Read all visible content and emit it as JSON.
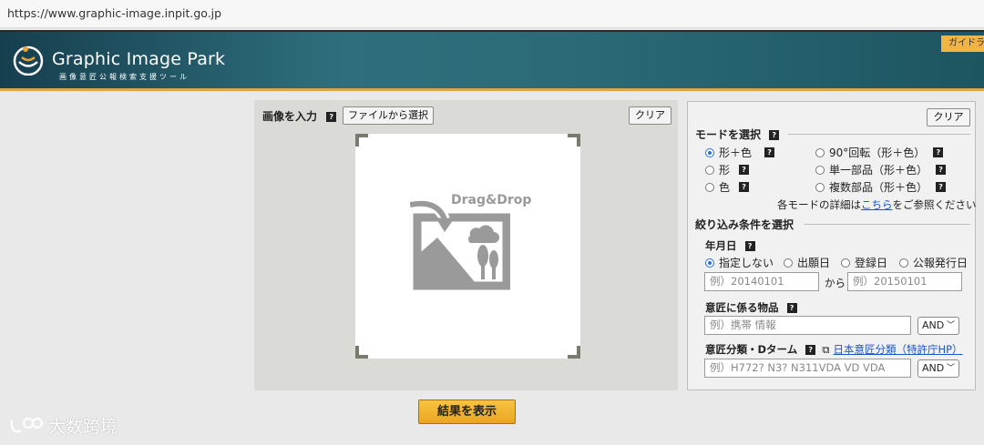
{
  "browser": {
    "url": "https://www.graphic-image.inpit.go.jp"
  },
  "header": {
    "title": "Graphic Image Park",
    "subtitle": "画像意匠公報検索支援ツール",
    "guide_tab": "ガイドラ",
    "colors": {
      "band": "#2b6976",
      "accent": "#e3a53b"
    }
  },
  "input_panel": {
    "title": "画像を入力",
    "file_button": "ファイルから選択",
    "clear_button": "クリア",
    "drop_text": "Drag&Drop"
  },
  "mode_panel": {
    "clear_button": "クリア",
    "title": "モードを選択",
    "modes": [
      {
        "label": "形＋色",
        "selected": true
      },
      {
        "label": "90°回転（形＋色）",
        "selected": false
      },
      {
        "label": "形",
        "selected": false
      },
      {
        "label": "単一部品（形＋色）",
        "selected": false
      },
      {
        "label": "色",
        "selected": false
      },
      {
        "label": "複数部品（形＋色）",
        "selected": false
      }
    ],
    "detail_note_prefix": "各モードの詳細は",
    "detail_link": "こちら",
    "detail_note_suffix": "をご参照ください"
  },
  "filter_panel": {
    "title": "絞り込み条件を選択",
    "date_label": "年月日",
    "date_options": [
      {
        "label": "指定しない",
        "selected": true
      },
      {
        "label": "出願日",
        "selected": false
      },
      {
        "label": "登録日",
        "selected": false
      },
      {
        "label": "公報発行日",
        "selected": false
      }
    ],
    "date_from_placeholder": "例）20140101",
    "date_sep": "から",
    "date_to_placeholder": "例）20150101",
    "article_label": "意匠に係る物品",
    "article_placeholder": "例）携帯 情報",
    "article_operator": "AND",
    "class_label": "意匠分類・Dターム",
    "class_link": "日本意匠分類（特許庁HP）",
    "class_placeholder": "例）H772? N3? N311VDA VD VDA",
    "class_operator": "AND"
  },
  "submit_button": "結果を表示",
  "watermark": "大数跨境"
}
